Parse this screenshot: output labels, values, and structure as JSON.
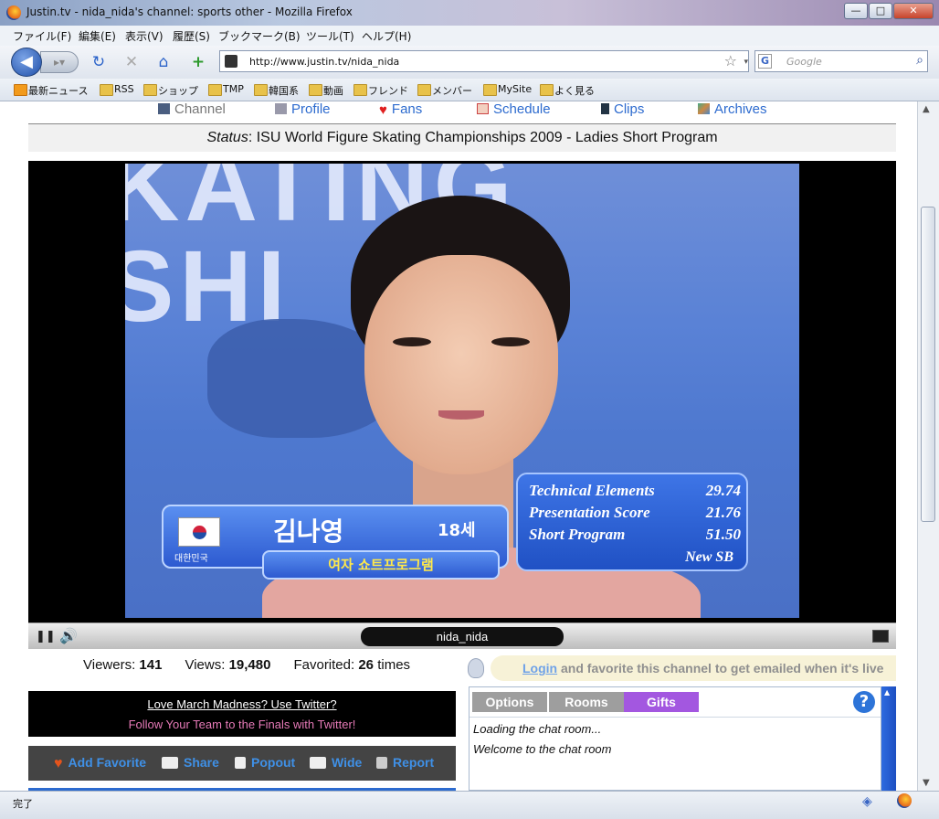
{
  "window": {
    "title": "Justin.tv - nida_nida's channel: sports other - Mozilla Firefox",
    "minimize_label": "—",
    "maximize_label": "□",
    "close_label": "✕"
  },
  "menu": [
    "ファイル(F)",
    "編集(E)",
    "表示(V)",
    "履歴(S)",
    "ブックマーク(B)",
    "ツール(T)",
    "ヘルプ(H)"
  ],
  "nav": {
    "url": "http://www.justin.tv/nida_nida",
    "search_placeholder": "Google",
    "search_engine_letter": "G"
  },
  "bookmarks": [
    "最新ニュース",
    "RSS",
    "ショップ",
    "TMP",
    "韓国系",
    "動画",
    "フレンド",
    "メンバー",
    "MySite",
    "よく見る"
  ],
  "channel_nav": {
    "items": [
      "Channel",
      "Profile",
      "Fans",
      "Schedule",
      "Clips",
      "Archives"
    ]
  },
  "status": {
    "label": "Status",
    "text": ": ISU World Figure Skating Championships 2009 - Ladies Short Program"
  },
  "video": {
    "background_text": "KATING\nSHI",
    "score": {
      "rows": [
        {
          "label": "Technical Elements",
          "value": "29.74"
        },
        {
          "label": "Presentation Score",
          "value": "21.76"
        },
        {
          "label": "Short Program",
          "value": "51.50"
        }
      ],
      "badge": "New SB"
    },
    "nameplate": {
      "country": "대한민국",
      "name": "김나영",
      "age": "18세",
      "event": "여자 쇼트프로그램"
    }
  },
  "player": {
    "channel_name": "nida_nida"
  },
  "stats": {
    "viewers_label": "Viewers:",
    "viewers_value": "141",
    "views_label": "Views:",
    "views_value": "19,480",
    "favorited_label": "Favorited:",
    "favorited_value": "26",
    "favorited_suffix": "times"
  },
  "promo": {
    "line1": "Love March Madness? Use Twitter?",
    "line2": "Follow Your Team to the Finals with Twitter!"
  },
  "actions": [
    "Add Favorite",
    "Share",
    "Popout",
    "Wide",
    "Report"
  ],
  "login_bar": {
    "link": "Login",
    "text": " and favorite this channel to get emailed when it's live"
  },
  "chat": {
    "tabs": [
      "Options",
      "Rooms",
      "Gifts"
    ],
    "help_label": "?",
    "messages": [
      "Loading the chat room...",
      "Welcome to the chat room"
    ]
  },
  "statusbar": {
    "text": "完了"
  },
  "colors": {
    "link_blue": "#2d6bcf",
    "gifts_tab": "#a357e0",
    "promo_pink": "#e77ab8"
  }
}
